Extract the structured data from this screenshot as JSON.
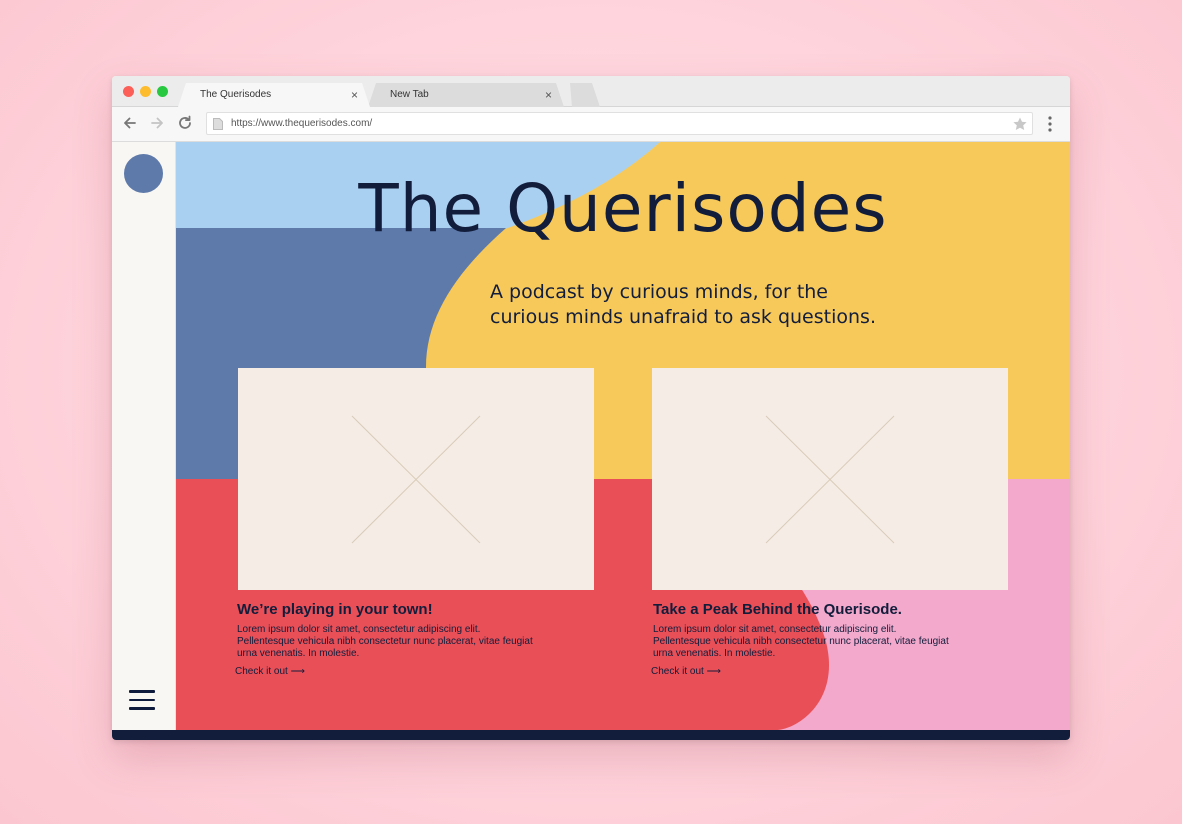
{
  "browser": {
    "tabs": [
      {
        "title": "The Querisodes",
        "active": true
      },
      {
        "title": "New Tab",
        "active": false
      }
    ],
    "close_icon": "×",
    "url": "https://www.thequerisodes.com/"
  },
  "site": {
    "title": "The Querisodes",
    "tagline_line1": "A podcast by curious minds, for the",
    "tagline_line2": "curious minds unafraid to ask questions.",
    "cards": [
      {
        "title": "We’re playing in your town!",
        "body": "Lorem ipsum dolor sit amet, consectetur adipiscing elit. Pellentesque vehicula nibh consectetur nunc placerat, vitae feugiat urna venenatis. In molestie.",
        "link": "Check it out ⟶"
      },
      {
        "title": "Take a Peak Behind the Querisode.",
        "body": "Lorem ipsum dolor sit amet, consectetur adipiscing elit. Pellentesque vehicula nibh consectetur nunc placerat, vitae feugiat urna venenatis. In molestie.",
        "link": "Check it out ⟶"
      }
    ]
  },
  "colors": {
    "light_blue": "#aad0f1",
    "slate_blue": "#5e7aaa",
    "yellow": "#f6c95a",
    "coral": "#e84f57",
    "pink": "#f3a9cb",
    "navy": "#121d3c",
    "card": "#f5ece5"
  },
  "icons": [
    "back-arrow-icon",
    "forward-arrow-icon",
    "reload-icon",
    "page-icon",
    "bookmark-star-icon",
    "kebab-menu-icon",
    "hamburger-menu-icon"
  ]
}
